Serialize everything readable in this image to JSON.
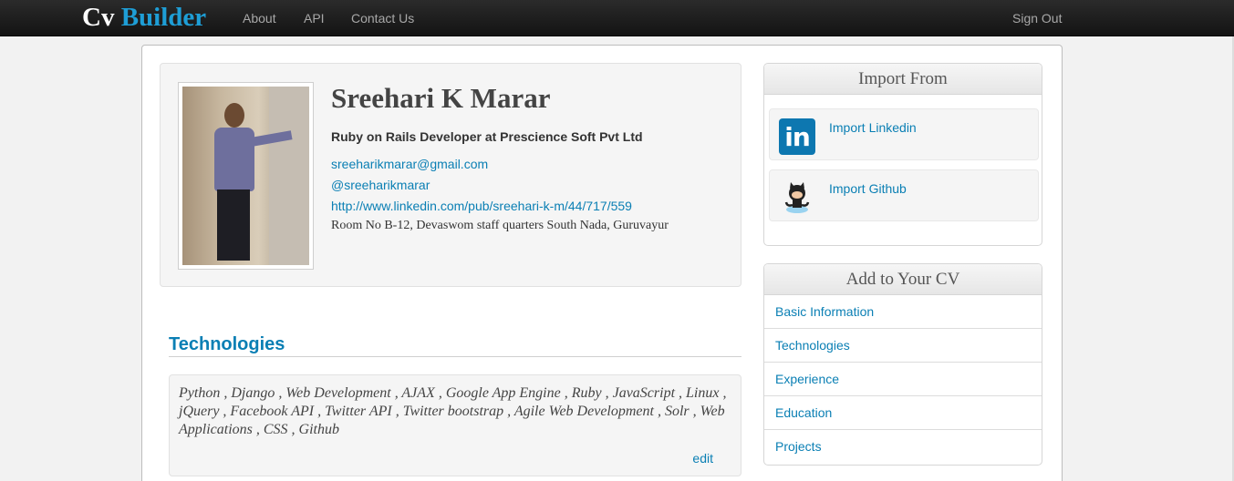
{
  "navbar": {
    "brand_part1": "Cv",
    "brand_part2": "Builder",
    "links": [
      "About",
      "API",
      "Contact Us"
    ],
    "sign_out": "Sign Out"
  },
  "profile": {
    "name": "Sreehari K Marar",
    "headline": "Ruby on Rails Developer at Prescience Soft Pvt Ltd",
    "email": "sreeharikmarar@gmail.com",
    "twitter": "@sreeharikmarar",
    "linkedin_url": "http://www.linkedin.com/pub/sreehari-k-m/44/717/559",
    "address": "Room No B-12, Devaswom staff quarters South Nada, Guruvayur"
  },
  "technologies": {
    "heading": "Technologies",
    "text": "Python , Django , Web Development , AJAX , Google App Engine , Ruby , JavaScript , Linux , jQuery , Facebook API , Twitter API , Twitter bootstrap , Agile Web Development , Solr , Web Applications , CSS , Github",
    "edit_label": "edit"
  },
  "import_from": {
    "heading": "Import From",
    "items": [
      {
        "label": "Import Linkedin",
        "icon": "linkedin-icon"
      },
      {
        "label": "Import Github",
        "icon": "github-octocat-icon"
      }
    ]
  },
  "add_to_cv": {
    "heading": "Add to Your CV",
    "items": [
      "Basic Information",
      "Technologies",
      "Experience",
      "Education",
      "Projects"
    ]
  }
}
